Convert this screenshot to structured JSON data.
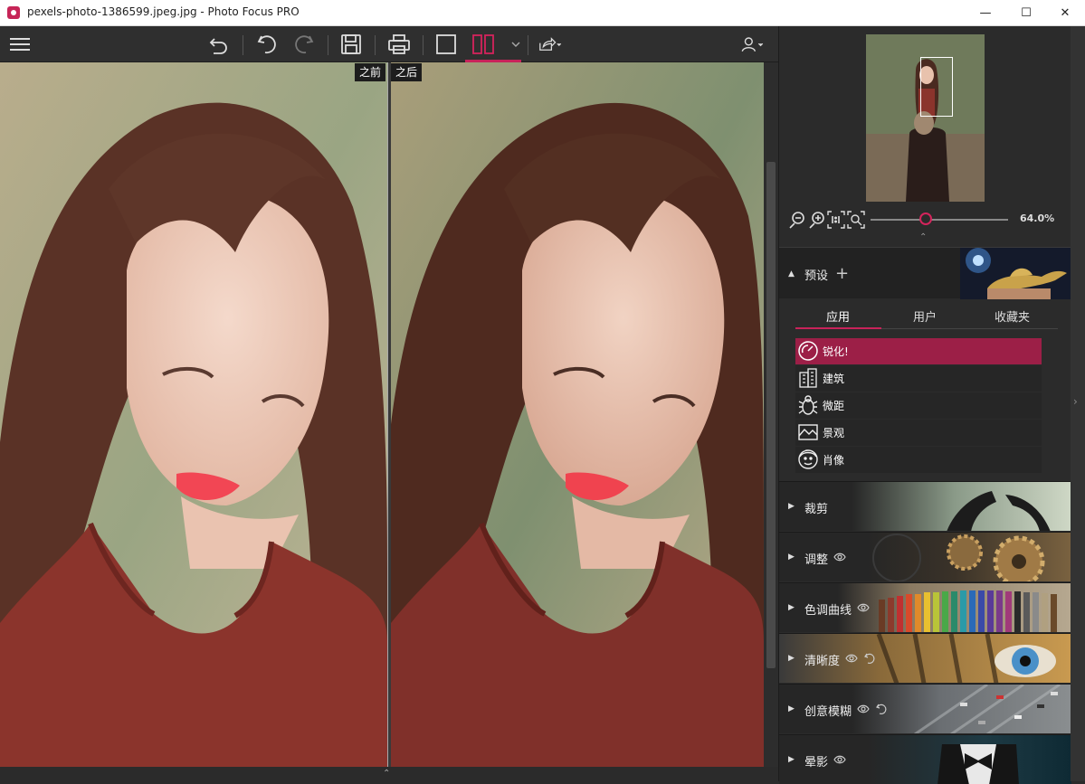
{
  "window": {
    "title": "pexels-photo-1386599.jpeg.jpg - Photo Focus PRO",
    "minimize": "—",
    "maximize": "☐",
    "close": "✕"
  },
  "toolbar": {
    "icons": [
      "menu-icon",
      "revert-icon",
      "undo-icon",
      "redo-icon",
      "save-icon",
      "print-icon",
      "single-view-icon",
      "split-view-icon",
      "chevron-down-icon",
      "share-icon",
      "user-icon"
    ],
    "active_color": "#c8235a"
  },
  "viewer": {
    "before_label": "之前",
    "after_label": "之后",
    "collapse": "⌃"
  },
  "navigator": {
    "zoom_value": "64.0%",
    "zoom_fraction": 0.64,
    "collapse": "⌃"
  },
  "presets": {
    "title": "预设",
    "add": "+",
    "tabs": [
      "应用",
      "用户",
      "收藏夹"
    ],
    "items": [
      {
        "label": "锐化!",
        "icon": "sharpen-gauge-icon",
        "active": true
      },
      {
        "label": "建筑",
        "icon": "building-icon",
        "active": false
      },
      {
        "label": "微距",
        "icon": "bug-icon",
        "active": false
      },
      {
        "label": "景观",
        "icon": "landscape-icon",
        "active": false
      },
      {
        "label": "肖像",
        "icon": "portrait-icon",
        "active": false
      }
    ]
  },
  "sections": [
    {
      "label": "裁剪",
      "eye": false,
      "reset": false
    },
    {
      "label": "调整",
      "eye": true,
      "reset": false
    },
    {
      "label": "色调曲线",
      "eye": true,
      "reset": false
    },
    {
      "label": "清晰度",
      "eye": true,
      "reset": true
    },
    {
      "label": "创意模糊",
      "eye": true,
      "reset": true
    },
    {
      "label": "晕影",
      "eye": true,
      "reset": false
    }
  ],
  "accent": "#c8235a"
}
